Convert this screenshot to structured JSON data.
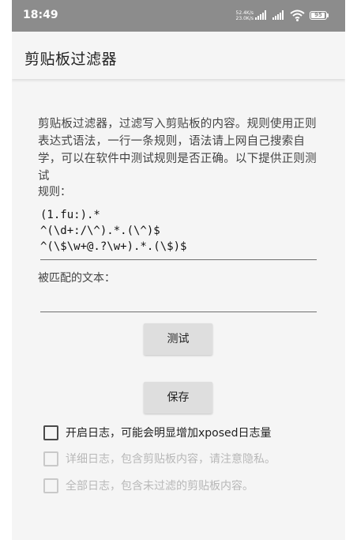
{
  "status_bar": {
    "time": "18:49",
    "net_speed_up": "52.4K/s",
    "net_speed_down": "23.0K/s",
    "battery": "95"
  },
  "app_bar": {
    "title": "剪贴板过滤器"
  },
  "description": "剪贴板过滤器，过滤写入剪贴板的内容。规则使用正则表达式语法，一行一条规则，语法请上网自己搜索自学，可以在软件中测试规则是否正确。以下提供正则测试",
  "rules": {
    "label": "规则：",
    "value": "(1.fu:).*\n^(\\d+:/\\^).*.(\\^)$\n^(\\$\\w+@.?\\w+).*.(\\$)$"
  },
  "match": {
    "label": "被匹配的文本：",
    "value": ""
  },
  "buttons": {
    "test": "测试",
    "save": "保存"
  },
  "options": [
    {
      "label": "开启日志，可能会明显增加xposed日志量",
      "checked": false,
      "enabled": true
    },
    {
      "label": "详细日志，包含剪贴板内容，请注意隐私。",
      "checked": false,
      "enabled": false
    },
    {
      "label": "全部日志，包含未过滤的剪贴板内容。",
      "checked": false,
      "enabled": false
    }
  ],
  "colors": {
    "status_bar": "#8c8c8c",
    "background": "#f5f5f5",
    "button": "#dedede"
  }
}
